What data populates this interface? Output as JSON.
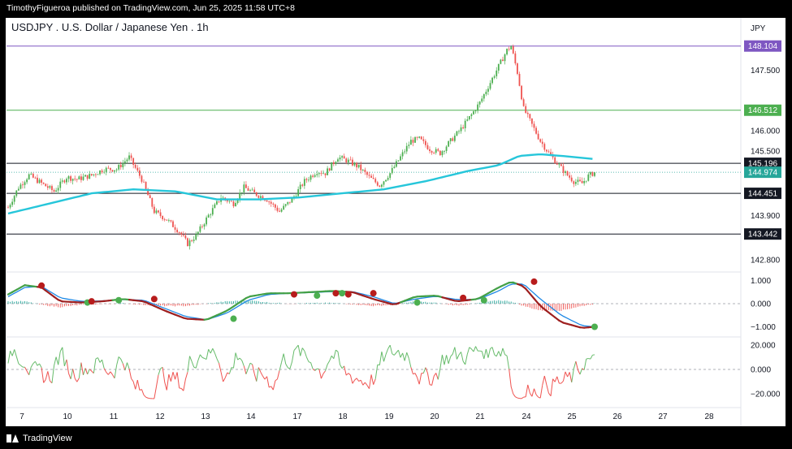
{
  "header": {
    "published": "TimothyFigueroa published on TradingView.com, Jun 25, 2025 11:58 UTC+8",
    "title": "USDJPY . U.S. Dollar / Japanese Yen . 1h",
    "currency": "JPY"
  },
  "footer": {
    "brand": "TradingView"
  },
  "colors": {
    "up": "#4caf50",
    "down": "#ef5350",
    "ma": "#26c6da",
    "purple": "#7e57c2",
    "green_line": "#66bb6a",
    "black_line": "#131722",
    "macd": "#9e1f1f",
    "signal": "#1e88e5",
    "osc_up": "#66bb6a",
    "osc_down": "#ef5350"
  },
  "chart_data": {
    "type": "candlestick",
    "x_labels": [
      "7",
      "10",
      "11",
      "12",
      "13",
      "14",
      "17",
      "18",
      "19",
      "20",
      "21",
      "24",
      "25",
      "26",
      "27",
      "28"
    ],
    "price_axis": {
      "ticks": [
        147.5,
        146.0,
        145.5,
        143.9,
        142.8
      ],
      "tick_labels": [
        "147.500",
        "146.000",
        "145.500",
        "143.900",
        "142.800"
      ],
      "range": [
        142.6,
        148.4
      ]
    },
    "horizontal_lines": [
      {
        "value": 148.104,
        "label": "148.104",
        "color": "#7e57c2"
      },
      {
        "value": 146.512,
        "label": "146.512",
        "color": "#4caf50"
      },
      {
        "value": 145.196,
        "label": "145.196",
        "color": "#131722"
      },
      {
        "value": 144.451,
        "label": "144.451",
        "color": "#131722"
      },
      {
        "value": 143.442,
        "label": "143.442",
        "color": "#131722"
      }
    ],
    "last_price": {
      "value": 144.974,
      "label": "144.974",
      "color": "#26a69a"
    },
    "price_path": [
      [
        0,
        144.1
      ],
      [
        5,
        144.6
      ],
      [
        10,
        144.9
      ],
      [
        16,
        144.7
      ],
      [
        22,
        144.5
      ],
      [
        28,
        144.85
      ],
      [
        33,
        144.8
      ],
      [
        40,
        144.9
      ],
      [
        46,
        145.05
      ],
      [
        52,
        145.05
      ],
      [
        58,
        145.35
      ],
      [
        64,
        144.8
      ],
      [
        70,
        144.0
      ],
      [
        76,
        143.8
      ],
      [
        82,
        143.5
      ],
      [
        86,
        143.2
      ],
      [
        90,
        143.4
      ],
      [
        96,
        143.9
      ],
      [
        102,
        144.35
      ],
      [
        108,
        144.2
      ],
      [
        113,
        144.6
      ],
      [
        118,
        144.45
      ],
      [
        124,
        144.3
      ],
      [
        130,
        144.0
      ],
      [
        136,
        144.3
      ],
      [
        142,
        144.75
      ],
      [
        148,
        145.0
      ],
      [
        152,
        144.95
      ],
      [
        158,
        145.35
      ],
      [
        163,
        145.25
      ],
      [
        168,
        145.1
      ],
      [
        173,
        144.85
      ],
      [
        178,
        144.65
      ],
      [
        183,
        144.95
      ],
      [
        188,
        145.35
      ],
      [
        193,
        145.75
      ],
      [
        197,
        145.8
      ],
      [
        202,
        145.55
      ],
      [
        207,
        145.45
      ],
      [
        212,
        145.75
      ],
      [
        217,
        146.05
      ],
      [
        222,
        146.4
      ],
      [
        226,
        146.7
      ],
      [
        230,
        147.1
      ],
      [
        235,
        147.6
      ],
      [
        239,
        148.0
      ],
      [
        241,
        148.1
      ],
      [
        244,
        147.45
      ],
      [
        247,
        146.55
      ],
      [
        251,
        146.15
      ],
      [
        255,
        145.75
      ],
      [
        259,
        145.45
      ],
      [
        263,
        145.2
      ],
      [
        267,
        144.95
      ],
      [
        271,
        144.75
      ],
      [
        275,
        144.7
      ],
      [
        278,
        144.88
      ],
      [
        281,
        144.97
      ]
    ],
    "moving_average": [
      [
        0,
        143.95
      ],
      [
        20,
        144.2
      ],
      [
        40,
        144.45
      ],
      [
        60,
        144.55
      ],
      [
        80,
        144.5
      ],
      [
        100,
        144.3
      ],
      [
        120,
        144.3
      ],
      [
        140,
        144.35
      ],
      [
        160,
        144.45
      ],
      [
        180,
        144.55
      ],
      [
        200,
        144.75
      ],
      [
        220,
        145.0
      ],
      [
        235,
        145.15
      ],
      [
        245,
        145.38
      ],
      [
        255,
        145.42
      ],
      [
        265,
        145.38
      ],
      [
        281,
        145.3
      ]
    ],
    "macd": {
      "ticks": [
        1.0,
        0.0,
        -1.0
      ],
      "tick_labels": [
        "1.000",
        "0.000",
        "−1.000"
      ],
      "macd_path": [
        [
          0,
          0.4
        ],
        [
          8,
          0.8
        ],
        [
          16,
          0.7
        ],
        [
          25,
          0.1
        ],
        [
          35,
          0.05
        ],
        [
          45,
          0.1
        ],
        [
          55,
          0.2
        ],
        [
          65,
          0.1
        ],
        [
          75,
          -0.3
        ],
        [
          85,
          -0.65
        ],
        [
          95,
          -0.7
        ],
        [
          105,
          -0.3
        ],
        [
          115,
          0.3
        ],
        [
          125,
          0.45
        ],
        [
          135,
          0.45
        ],
        [
          145,
          0.5
        ],
        [
          155,
          0.55
        ],
        [
          165,
          0.5
        ],
        [
          175,
          0.2
        ],
        [
          185,
          -0.05
        ],
        [
          195,
          0.3
        ],
        [
          205,
          0.35
        ],
        [
          215,
          0.1
        ],
        [
          225,
          0.2
        ],
        [
          235,
          0.7
        ],
        [
          241,
          0.95
        ],
        [
          247,
          0.75
        ],
        [
          255,
          -0.1
        ],
        [
          265,
          -0.8
        ],
        [
          275,
          -1.05
        ],
        [
          281,
          -1.0
        ]
      ],
      "signal_path": [
        [
          0,
          0.3
        ],
        [
          8,
          0.7
        ],
        [
          16,
          0.75
        ],
        [
          25,
          0.25
        ],
        [
          35,
          0.1
        ],
        [
          45,
          0.12
        ],
        [
          55,
          0.18
        ],
        [
          65,
          0.15
        ],
        [
          75,
          -0.2
        ],
        [
          85,
          -0.55
        ],
        [
          95,
          -0.7
        ],
        [
          105,
          -0.4
        ],
        [
          115,
          0.15
        ],
        [
          125,
          0.4
        ],
        [
          135,
          0.45
        ],
        [
          145,
          0.48
        ],
        [
          155,
          0.52
        ],
        [
          165,
          0.52
        ],
        [
          175,
          0.3
        ],
        [
          185,
          0.0
        ],
        [
          195,
          0.2
        ],
        [
          205,
          0.32
        ],
        [
          215,
          0.18
        ],
        [
          225,
          0.18
        ],
        [
          235,
          0.55
        ],
        [
          241,
          0.85
        ],
        [
          247,
          0.85
        ],
        [
          255,
          0.2
        ],
        [
          265,
          -0.5
        ],
        [
          275,
          -0.95
        ],
        [
          281,
          -1.0
        ]
      ],
      "cross_up": [
        [
          38,
          0.05
        ],
        [
          53,
          0.15
        ],
        [
          108,
          -0.65
        ],
        [
          148,
          0.35
        ],
        [
          160,
          0.45
        ],
        [
          196,
          0.05
        ],
        [
          228,
          0.15
        ],
        [
          281,
          -1.0
        ]
      ],
      "cross_down": [
        [
          16,
          0.78
        ],
        [
          40,
          0.1
        ],
        [
          70,
          0.2
        ],
        [
          137,
          0.4
        ],
        [
          157,
          0.45
        ],
        [
          163,
          0.4
        ],
        [
          175,
          0.45
        ],
        [
          218,
          0.25
        ],
        [
          252,
          0.95
        ]
      ]
    },
    "oscillator": {
      "ticks": [
        20.0,
        0.0,
        -20.0
      ],
      "tick_labels": [
        "20.000",
        "0.000",
        "−20.000"
      ],
      "range": [
        -26,
        25
      ]
    }
  }
}
